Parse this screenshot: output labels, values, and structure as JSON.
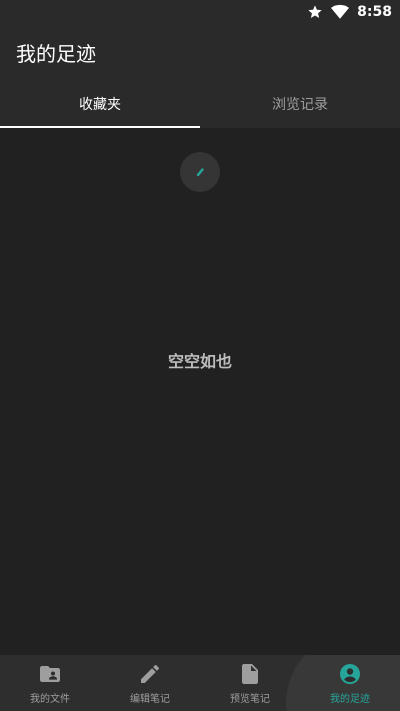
{
  "status_bar": {
    "time": "8:58",
    "icons": [
      "star-icon",
      "wifi-icon"
    ]
  },
  "app_bar": {
    "title": "我的足迹"
  },
  "tabs": [
    {
      "label": "收藏夹",
      "active": true
    },
    {
      "label": "浏览记录",
      "active": false
    }
  ],
  "content": {
    "empty_text": "空空如也",
    "loading": true
  },
  "bottom_nav": {
    "items": [
      {
        "label": "我的文件",
        "icon": "folder-user-icon",
        "active": false
      },
      {
        "label": "编辑笔记",
        "icon": "pencil-icon",
        "active": false
      },
      {
        "label": "预览笔记",
        "icon": "document-icon",
        "active": false
      },
      {
        "label": "我的足迹",
        "icon": "account-circle-icon",
        "active": true
      }
    ]
  },
  "colors": {
    "accent": "#26a69a",
    "background": "#212121",
    "toolbar": "#2a2a2a",
    "inactive_text": "#9e9e9e"
  }
}
